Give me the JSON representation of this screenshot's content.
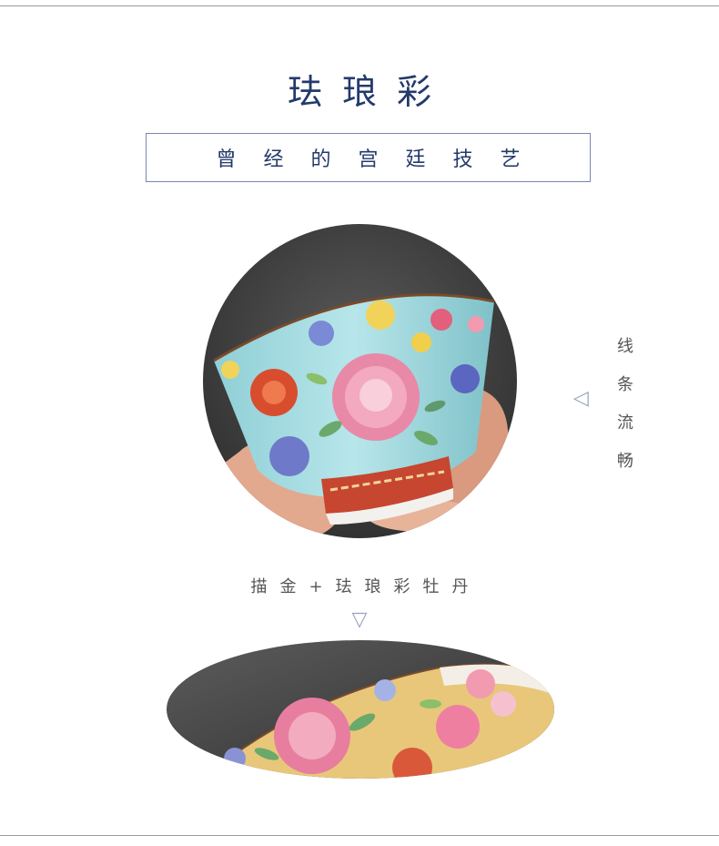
{
  "header": {
    "title": "珐琅彩",
    "subtitle": "曾经的宫廷技艺"
  },
  "side_note": {
    "arrow_icon": "triangle-left-icon",
    "chars": [
      "线",
      "条",
      "流",
      "畅"
    ]
  },
  "caption": {
    "text": "描金+珐琅彩牡丹",
    "arrow_icon": "triangle-down-icon"
  },
  "colors": {
    "title_color": "#233a6b",
    "accent": "#9aa3c0",
    "turquoise_glaze": "#9fd9df",
    "yellow_glaze": "#e8c77a",
    "peony_pink": "#e889a8",
    "rim_red": "#c7462f"
  }
}
